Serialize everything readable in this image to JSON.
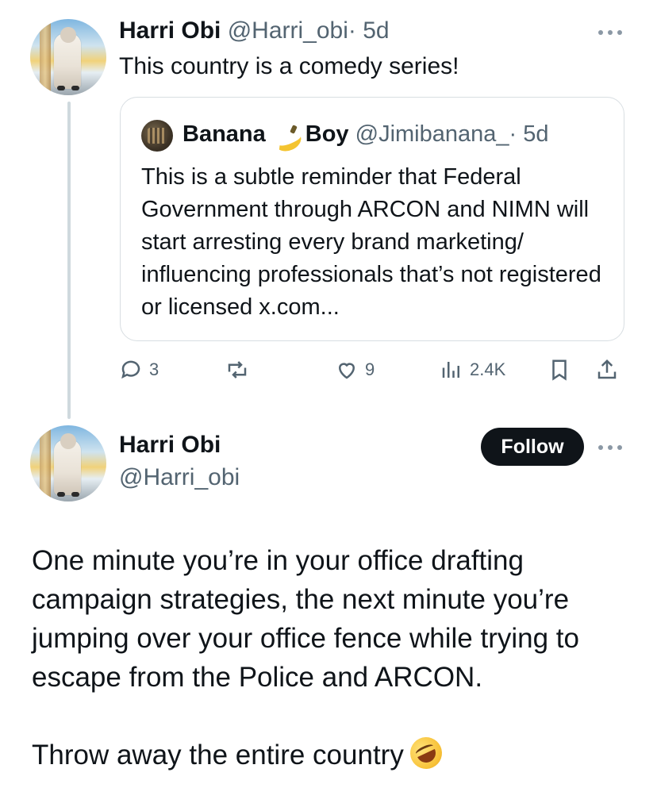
{
  "quoted_post": {
    "author_name": "Harri Obi",
    "author_handle": "@Harri_obi",
    "time_ago": "· 5d",
    "text": "This country is a comedy series!",
    "quote": {
      "author_name_part1": "Banana",
      "author_name_part2": "Boy",
      "author_handle": "@Jimibanana_",
      "time_ago": "· 5d",
      "text": "This is a subtle reminder that Federal Government through ARCON and NIMN will start arresting every brand marketing/ influencing professionals that’s not registered or licensed x.com..."
    },
    "stats": {
      "replies": "3",
      "reposts": "",
      "likes": "9",
      "views": "2.4K"
    }
  },
  "main_post": {
    "author_name": "Harri Obi",
    "author_handle": "@Harri_obi",
    "follow_label": "Follow",
    "paragraph1": "One minute you’re in your office drafting campaign strategies, the next minute you’re jumping over your office fence while trying to escape from the Police and ARCON.",
    "paragraph2": "Throw away the entire country"
  },
  "icons": {
    "reply": "reply-icon",
    "repost": "repost-icon",
    "like": "heart-icon",
    "views": "views-icon",
    "bookmark": "bookmark-icon",
    "share": "share-icon",
    "more": "more-icon",
    "emoji": "rolling-on-floor-laughing-emoji"
  },
  "colors": {
    "text": "#0f1419",
    "muted": "#536471",
    "border": "#d8dee2",
    "follow_bg": "#0f1419"
  }
}
